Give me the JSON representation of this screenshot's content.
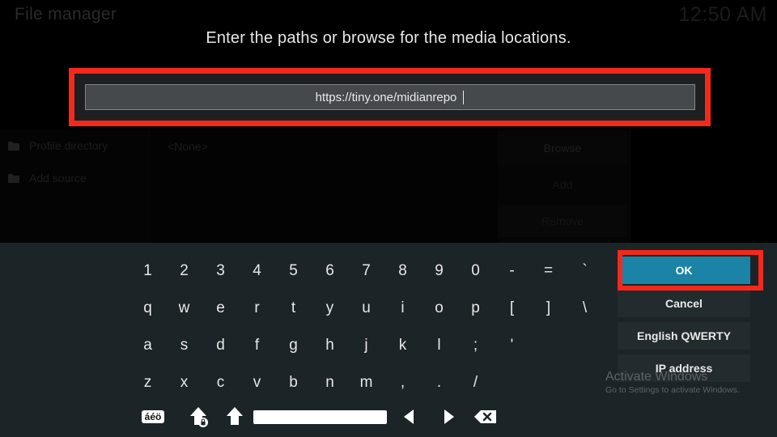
{
  "window": {
    "title": "File manager",
    "clock": "12:50 AM"
  },
  "dialog": {
    "heading": "Enter the paths or browse for the media locations.",
    "input": {
      "value": "https://tiny.one/midianrepo",
      "placeholder": "",
      "caret": "|"
    }
  },
  "file_manager": {
    "rows": [
      {
        "label": "Profile directory",
        "icon": "folder-icon"
      },
      {
        "label": "Add source",
        "icon": "folder-icon"
      }
    ],
    "value_none": "<None>",
    "buttons": [
      {
        "label": "Browse"
      },
      {
        "label": "Add"
      },
      {
        "label": "Remove"
      }
    ]
  },
  "keyboard": {
    "layout_name": "English QWERTY",
    "rows": [
      [
        "1",
        "2",
        "3",
        "4",
        "5",
        "6",
        "7",
        "8",
        "9",
        "0",
        "-",
        "=",
        "`"
      ],
      [
        "q",
        "w",
        "e",
        "r",
        "t",
        "y",
        "u",
        "i",
        "o",
        "p",
        "[",
        "]",
        "\\"
      ],
      [
        "a",
        "s",
        "d",
        "f",
        "g",
        "h",
        "j",
        "k",
        "l",
        ";",
        "'"
      ],
      [
        "z",
        "x",
        "c",
        "v",
        "b",
        "n",
        "m",
        ",",
        ".",
        "/"
      ]
    ],
    "function_keys": {
      "accent": {
        "label": "áéö",
        "icon": "accent-characters-icon"
      },
      "capslock": {
        "icon": "caps-lock-icon"
      },
      "shift": {
        "icon": "shift-icon"
      },
      "space": {
        "icon": "spacebar-icon"
      },
      "cursor_left": {
        "icon": "arrow-left-icon"
      },
      "cursor_right": {
        "icon": "arrow-right-icon"
      },
      "backspace": {
        "icon": "backspace-icon"
      }
    }
  },
  "actions": {
    "ok": "OK",
    "cancel": "Cancel",
    "layout": "English QWERTY",
    "input_type": "IP address"
  },
  "watermark": {
    "line1": "Activate Windows",
    "line2": "Go to Settings to activate Windows."
  },
  "colors": {
    "accent_blue": "#1b83a6",
    "highlight_red": "#f4291c",
    "keyboard_bg": "#1b2427",
    "button_bg": "#222b2e"
  }
}
